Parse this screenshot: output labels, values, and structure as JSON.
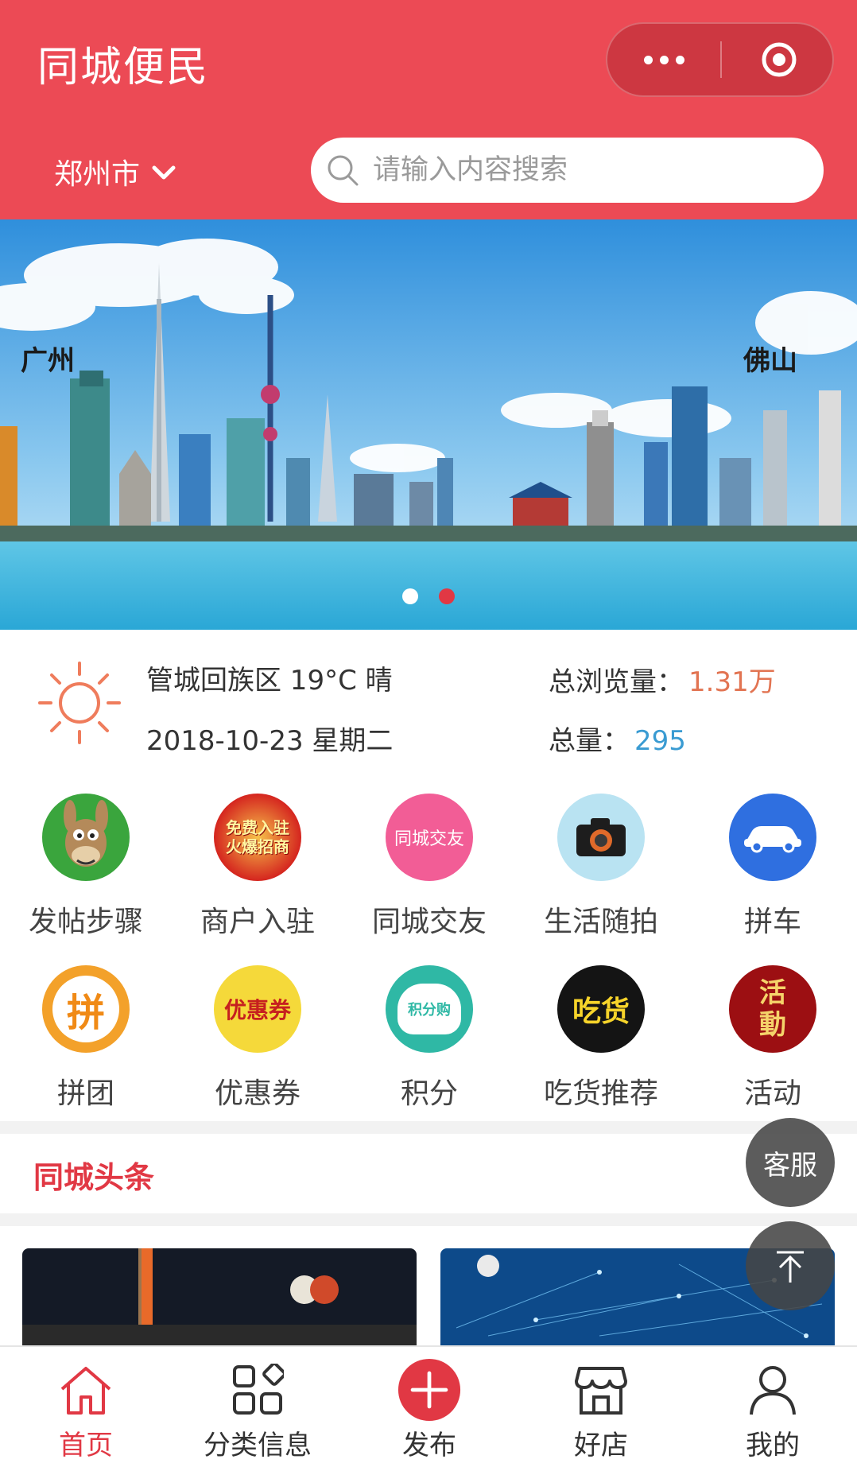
{
  "header": {
    "title": "同城便民",
    "city": "郑州市",
    "search_placeholder": "请输入内容搜索"
  },
  "banner": {
    "label_left": "广州",
    "label_right": "佛山",
    "page_count": 2,
    "active_page": 2
  },
  "info": {
    "weather": "管城回族区 19°C 晴",
    "date": "2018-10-23 星期二",
    "views_label": "总浏览量：",
    "views_value": "1.31万",
    "total_label": "总量：",
    "total_value": "295"
  },
  "categories": [
    {
      "label": "发帖步骤",
      "icon": "donkey-icon"
    },
    {
      "label": "商户入驻",
      "icon": "merchant-join-icon",
      "icon_text": "免费入驻 火爆招商"
    },
    {
      "label": "同城交友",
      "icon": "dating-icon",
      "icon_text": "同城交友"
    },
    {
      "label": "生活随拍",
      "icon": "camera-icon"
    },
    {
      "label": "拼车",
      "icon": "car-icon"
    },
    {
      "label": "拼团",
      "icon": "group-buy-icon",
      "icon_text": "拼"
    },
    {
      "label": "优惠券",
      "icon": "coupon-icon",
      "icon_text": "优惠券"
    },
    {
      "label": "积分",
      "icon": "points-bag-icon",
      "icon_text": "积分购"
    },
    {
      "label": "吃货推荐",
      "icon": "foodie-icon",
      "icon_text": "吃货"
    },
    {
      "label": "活动",
      "icon": "activity-icon",
      "icon_text": "活動"
    }
  ],
  "section": {
    "headline": "同城头条"
  },
  "floating": {
    "service": "客服"
  },
  "tabbar": [
    {
      "label": "首页",
      "icon": "home-icon",
      "active": true
    },
    {
      "label": "分类信息",
      "icon": "category-grid-icon",
      "active": false
    },
    {
      "label": "发布",
      "icon": "plus-icon",
      "active": false
    },
    {
      "label": "好店",
      "icon": "shop-icon",
      "active": false
    },
    {
      "label": "我的",
      "icon": "user-icon",
      "active": false
    }
  ],
  "colors": {
    "brand_red": "#ec4a55",
    "accent_red": "#e13844",
    "views_orange": "#e27452",
    "total_blue": "#3a9bd2"
  }
}
